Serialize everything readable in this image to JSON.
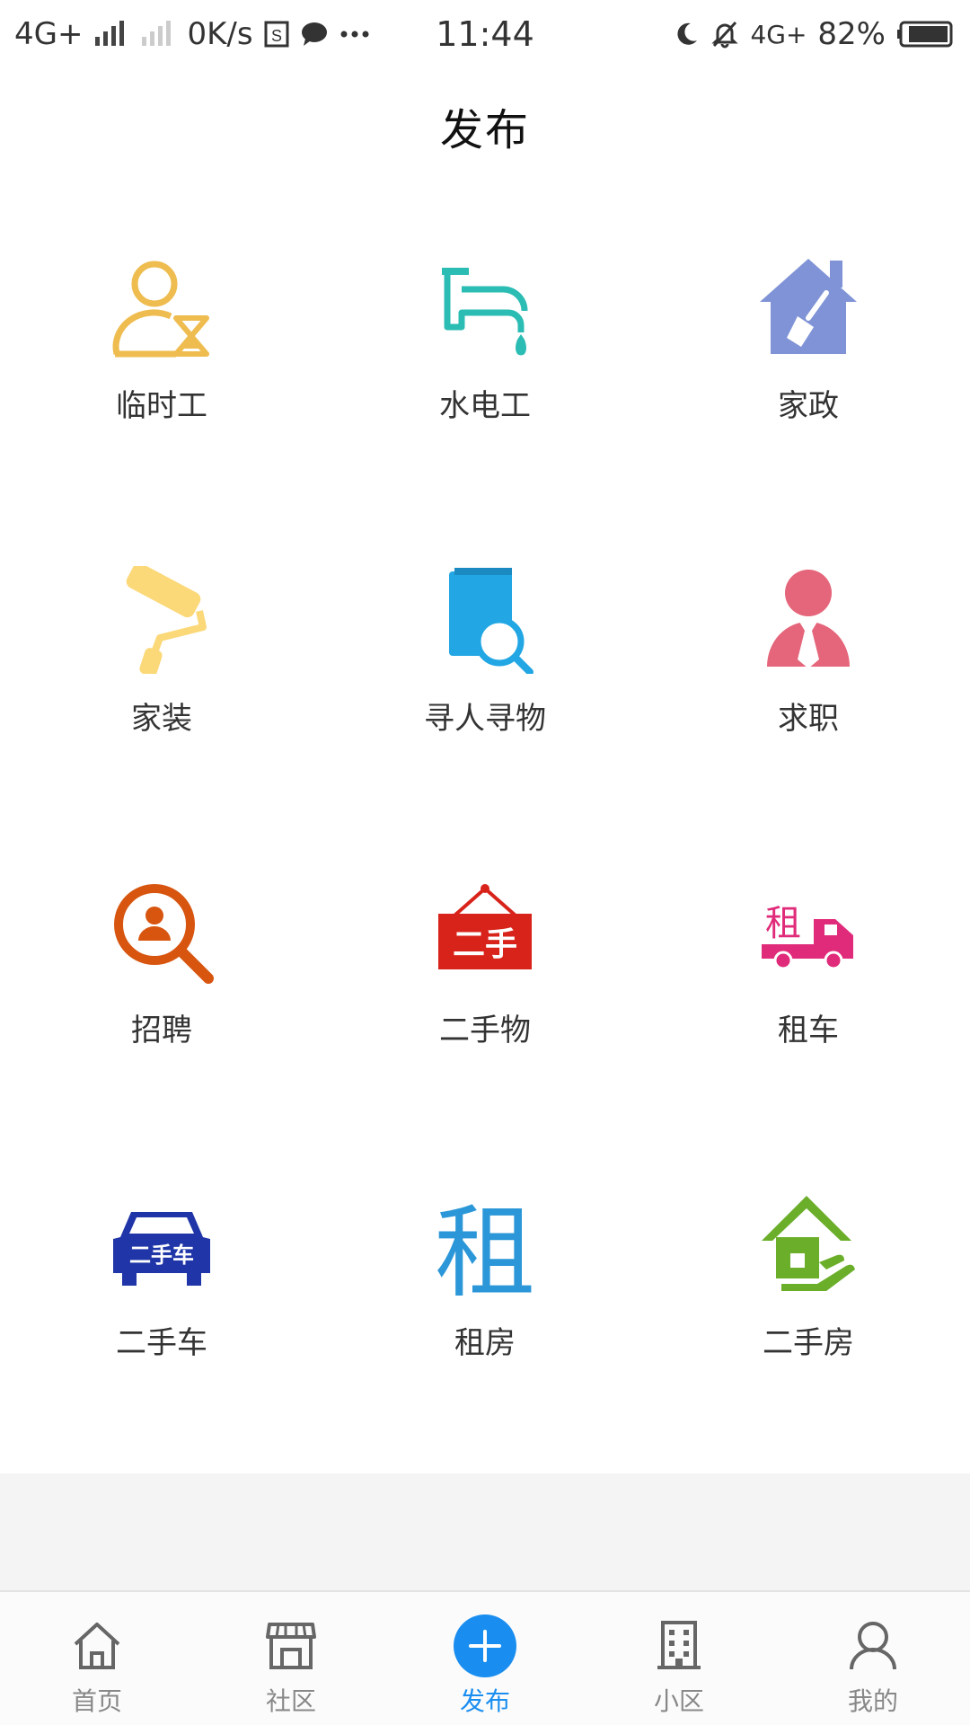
{
  "status_bar": {
    "network": "4G+",
    "speed": "0K/s",
    "time": "11:44",
    "network2": "4G+",
    "battery": "82%"
  },
  "header": {
    "title": "发布"
  },
  "grid": {
    "items": [
      {
        "label": "临时工",
        "icon": "temp-worker-icon",
        "color": "#eebc4f"
      },
      {
        "label": "水电工",
        "icon": "faucet-icon",
        "color": "#2bbcb4"
      },
      {
        "label": "家政",
        "icon": "house-broom-icon",
        "color": "#7f93d6"
      },
      {
        "label": "家装",
        "icon": "paint-roller-icon",
        "color": "#fbd878"
      },
      {
        "label": "寻人寻物",
        "icon": "search-document-icon",
        "color": "#22a7e4"
      },
      {
        "label": "求职",
        "icon": "job-seeker-icon",
        "color": "#e5657a"
      },
      {
        "label": "招聘",
        "icon": "recruit-search-icon",
        "color": "#d7550f"
      },
      {
        "label": "二手物",
        "icon": "secondhand-sign-icon",
        "color": "#d8231b",
        "icon_text": "二手"
      },
      {
        "label": "租车",
        "icon": "rent-truck-icon",
        "color": "#e02a7a",
        "icon_text": "租"
      },
      {
        "label": "二手车",
        "icon": "secondhand-car-icon",
        "color": "#1f35a8",
        "icon_text": "二手车"
      },
      {
        "label": "租房",
        "icon": "rent-house-glyph-icon",
        "color": "#2c97d8",
        "icon_text": "租"
      },
      {
        "label": "二手房",
        "icon": "secondhand-house-icon",
        "color": "#6aae2a"
      }
    ]
  },
  "bottom_nav": {
    "items": [
      {
        "label": "首页",
        "icon": "home-icon",
        "active": false
      },
      {
        "label": "社区",
        "icon": "store-icon",
        "active": false
      },
      {
        "label": "发布",
        "icon": "plus-circle-icon",
        "active": true
      },
      {
        "label": "小区",
        "icon": "building-icon",
        "active": false
      },
      {
        "label": "我的",
        "icon": "person-icon",
        "active": false
      }
    ],
    "active_color": "#1a8ef0",
    "inactive_color": "#888888"
  }
}
